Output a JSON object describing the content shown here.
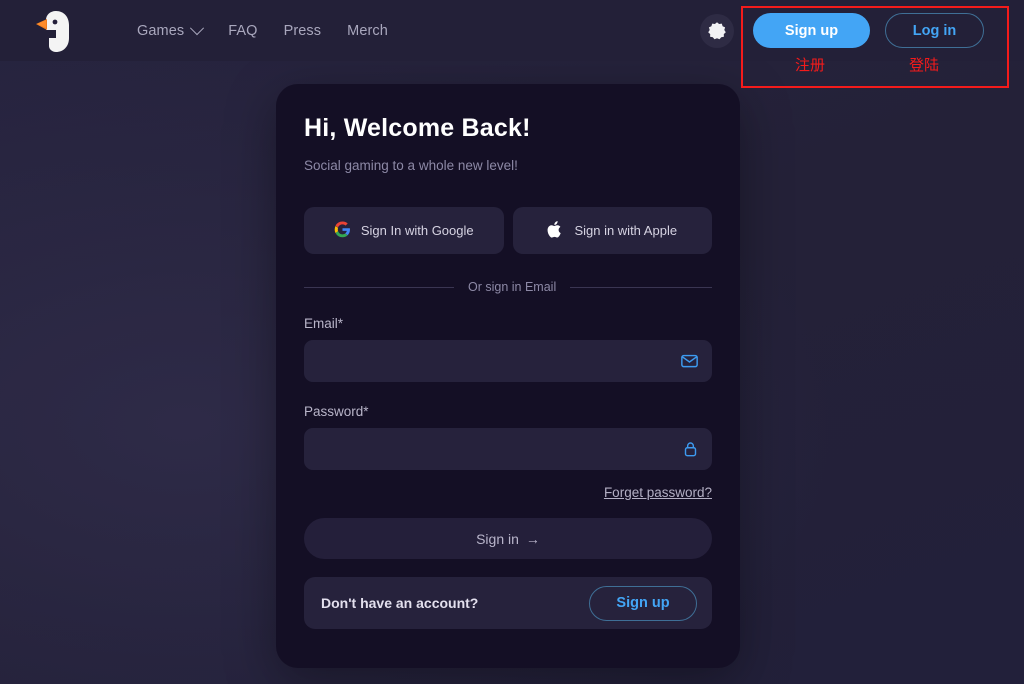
{
  "header": {
    "logo_icon": "goose-logo-icon",
    "nav": [
      {
        "label": "Games",
        "has_dropdown": true,
        "icon": "chevron-down-icon"
      },
      {
        "label": "FAQ",
        "has_dropdown": false
      },
      {
        "label": "Press",
        "has_dropdown": false
      },
      {
        "label": "Merch",
        "has_dropdown": false
      }
    ],
    "theme_toggle_icon": "dark-mode-toggle-icon",
    "signup_label": "Sign up",
    "login_label": "Log in"
  },
  "annotation": {
    "signup_cn": "注册",
    "login_cn": "登陆",
    "box_color": "#f41b1b"
  },
  "card": {
    "title": "Hi, Welcome Back!",
    "subtitle": "Social gaming to a whole new level!",
    "social": [
      {
        "label": "Sign In with Google",
        "icon": "google-icon"
      },
      {
        "label": "Sign in with Apple",
        "icon": "apple-icon"
      }
    ],
    "divider_text": "Or sign in Email",
    "email": {
      "label": "Email*",
      "value": "",
      "placeholder": "",
      "icon": "envelope-icon"
    },
    "password": {
      "label": "Password*",
      "value": "",
      "placeholder": "",
      "icon": "lock-icon"
    },
    "forget_label": "Forget password?",
    "signin_label": "Sign in",
    "signin_arrow": "→",
    "bottom_text": "Don't have an account?",
    "bottom_signup_label": "Sign up"
  },
  "colors": {
    "accent_blue": "#43a5f5",
    "card_bg": "#140f25",
    "page_bg": "#242138",
    "input_bg": "#26223c",
    "annotation_red": "#f41b1b"
  }
}
